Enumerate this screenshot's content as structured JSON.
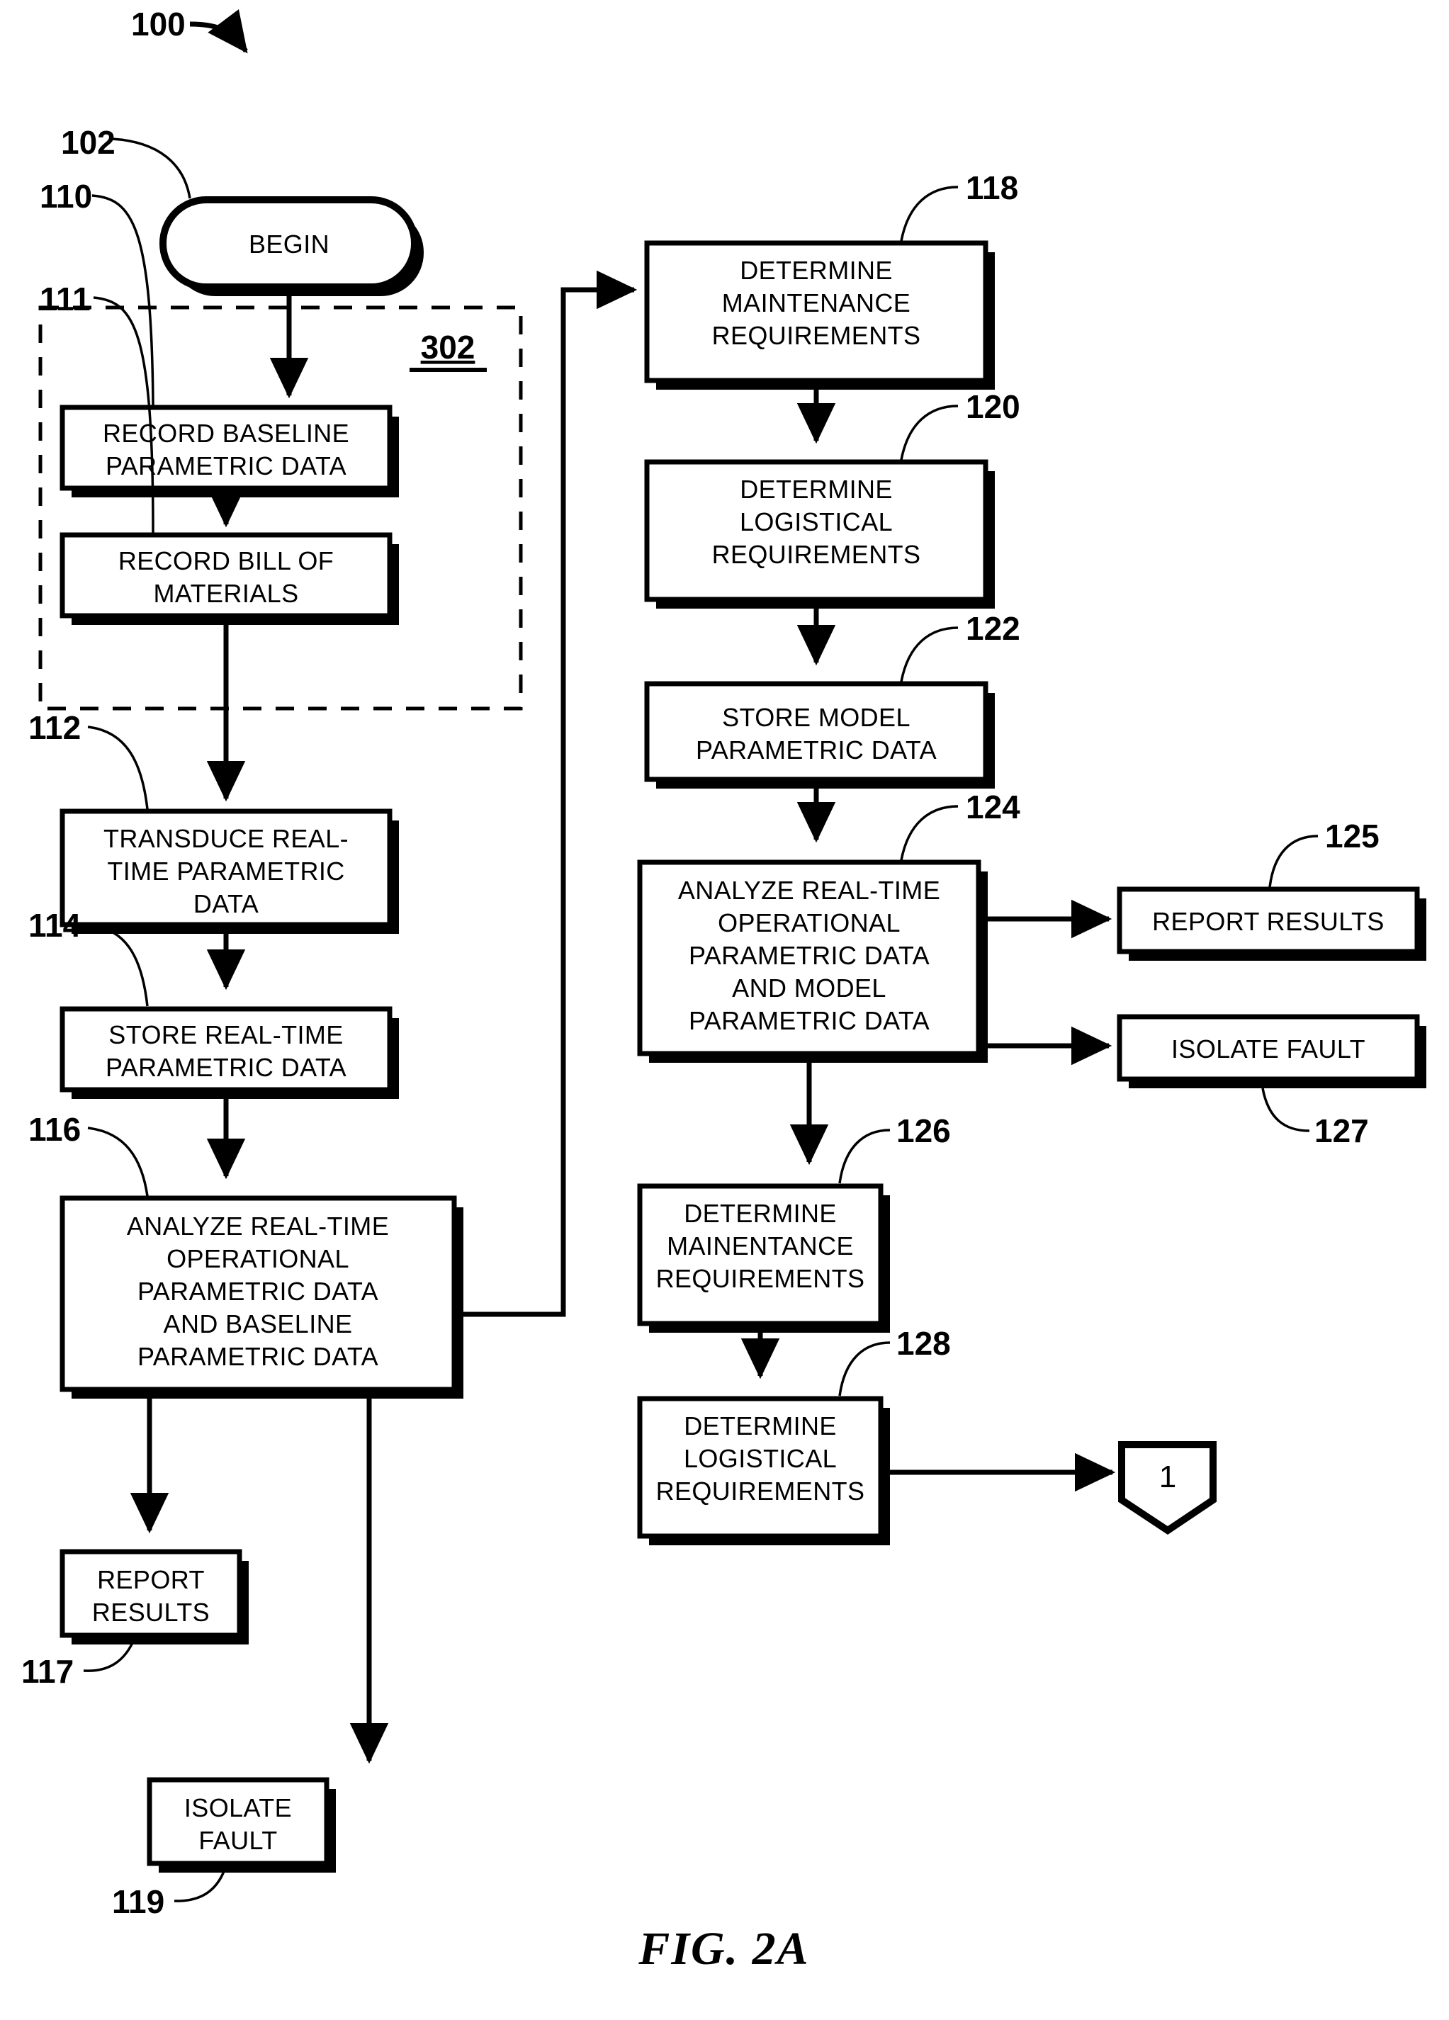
{
  "figure": {
    "caption": "FIG. 2A",
    "diagram_number": "100",
    "group_label": "302"
  },
  "nodes": [
    {
      "id": "102",
      "ref": "102",
      "shape": "terminator",
      "lines": [
        "BEGIN"
      ]
    },
    {
      "id": "110",
      "ref": "110",
      "shape": "process",
      "lines": [
        "RECORD BASELINE",
        "PARAMETRIC DATA"
      ]
    },
    {
      "id": "111",
      "ref": "111",
      "shape": "process",
      "lines": [
        "RECORD BILL OF",
        "MATERIALS"
      ]
    },
    {
      "id": "112",
      "ref": "112",
      "shape": "process",
      "lines": [
        "TRANSDUCE REAL-",
        "TIME PARAMETRIC",
        "DATA"
      ]
    },
    {
      "id": "114",
      "ref": "114",
      "shape": "process",
      "lines": [
        "STORE REAL-TIME",
        "PARAMETRIC DATA"
      ]
    },
    {
      "id": "116",
      "ref": "116",
      "shape": "process",
      "lines": [
        "ANALYZE REAL-TIME",
        "OPERATIONAL",
        "PARAMETRIC DATA",
        "AND BASELINE",
        "PARAMETRIC DATA"
      ]
    },
    {
      "id": "117",
      "ref": "117",
      "shape": "process",
      "lines": [
        "REPORT",
        "RESULTS"
      ]
    },
    {
      "id": "119",
      "ref": "119",
      "shape": "process",
      "lines": [
        "ISOLATE",
        "FAULT"
      ]
    },
    {
      "id": "118",
      "ref": "118",
      "shape": "process",
      "lines": [
        "DETERMINE",
        "MAINTENANCE",
        "REQUIREMENTS"
      ]
    },
    {
      "id": "120",
      "ref": "120",
      "shape": "process",
      "lines": [
        "DETERMINE",
        "LOGISTICAL",
        "REQUIREMENTS"
      ]
    },
    {
      "id": "122",
      "ref": "122",
      "shape": "process",
      "lines": [
        "STORE MODEL",
        "PARAMETRIC DATA"
      ]
    },
    {
      "id": "124",
      "ref": "124",
      "shape": "process",
      "lines": [
        "ANALYZE REAL-TIME",
        "OPERATIONAL",
        "PARAMETRIC DATA",
        "AND MODEL",
        "PARAMETRIC DATA"
      ]
    },
    {
      "id": "125",
      "ref": "125",
      "shape": "process",
      "lines": [
        "REPORT RESULTS"
      ]
    },
    {
      "id": "127",
      "ref": "127",
      "shape": "process",
      "lines": [
        "ISOLATE FAULT"
      ]
    },
    {
      "id": "126",
      "ref": "126",
      "shape": "process",
      "lines": [
        "DETERMINE",
        "MAINENTANCE",
        "REQUIREMENTS"
      ]
    },
    {
      "id": "128",
      "ref": "128",
      "shape": "process",
      "lines": [
        "DETERMINE",
        "LOGISTICAL",
        "REQUIREMENTS"
      ]
    },
    {
      "id": "conn1",
      "ref": "",
      "shape": "connector",
      "lines": [
        "1"
      ]
    }
  ],
  "labels": {
    "n102_l0": "BEGIN",
    "n110_l0": "RECORD BASELINE",
    "n110_l1": "PARAMETRIC DATA",
    "n111_l0": "RECORD BILL OF",
    "n111_l1": "MATERIALS",
    "n112_l0": "TRANSDUCE REAL-",
    "n112_l1": "TIME PARAMETRIC",
    "n112_l2": "DATA",
    "n114_l0": "STORE REAL-TIME",
    "n114_l1": "PARAMETRIC DATA",
    "n116_l0": "ANALYZE REAL-TIME",
    "n116_l1": "OPERATIONAL",
    "n116_l2": "PARAMETRIC DATA",
    "n116_l3": "AND BASELINE",
    "n116_l4": "PARAMETRIC DATA",
    "n117_l0": "REPORT",
    "n117_l1": "RESULTS",
    "n119_l0": "ISOLATE",
    "n119_l1": "FAULT",
    "n118_l0": "DETERMINE",
    "n118_l1": "MAINTENANCE",
    "n118_l2": "REQUIREMENTS",
    "n120_l0": "DETERMINE",
    "n120_l1": "LOGISTICAL",
    "n120_l2": "REQUIREMENTS",
    "n122_l0": "STORE MODEL",
    "n122_l1": "PARAMETRIC DATA",
    "n124_l0": "ANALYZE REAL-TIME",
    "n124_l1": "OPERATIONAL",
    "n124_l2": "PARAMETRIC DATA",
    "n124_l3": "AND MODEL",
    "n124_l4": "PARAMETRIC DATA",
    "n125_l0": "REPORT RESULTS",
    "n127_l0": "ISOLATE FAULT",
    "n126_l0": "DETERMINE",
    "n126_l1": "MAINENTANCE",
    "n126_l2": "REQUIREMENTS",
    "n128_l0": "DETERMINE",
    "n128_l1": "LOGISTICAL",
    "n128_l2": "REQUIREMENTS",
    "conn1_l0": "1"
  },
  "refs": {
    "r100": "100",
    "r102": "102",
    "r110": "110",
    "r111": "111",
    "r112": "112",
    "r114": "114",
    "r116": "116",
    "r117": "117",
    "r118": "118",
    "r119": "119",
    "r120": "120",
    "r122": "122",
    "r124": "124",
    "r125": "125",
    "r126": "126",
    "r127": "127",
    "r128": "128",
    "r302": "302"
  },
  "colors": {
    "ink": "#000000",
    "paper": "#ffffff"
  }
}
